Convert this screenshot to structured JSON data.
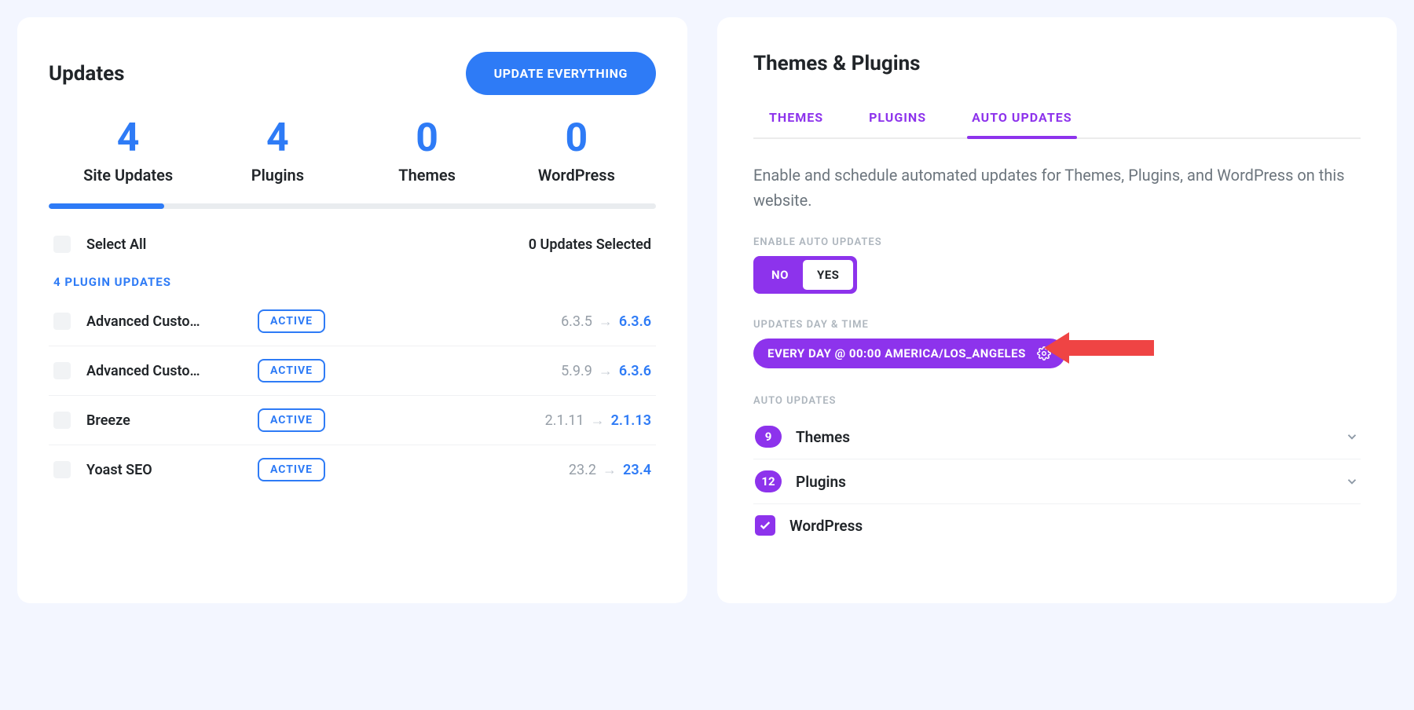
{
  "updates": {
    "title": "Updates",
    "update_all_label": "UPDATE EVERYTHING",
    "stats": {
      "site_updates": {
        "value": "4",
        "label": "Site Updates"
      },
      "plugins": {
        "value": "4",
        "label": "Plugins"
      },
      "themes": {
        "value": "0",
        "label": "Themes"
      },
      "wordpress": {
        "value": "0",
        "label": "WordPress"
      }
    },
    "select_all_label": "Select All",
    "selected_count_text": "0 Updates Selected",
    "plugin_section_title": "4 PLUGIN UPDATES",
    "plugins_list": [
      {
        "name": "Advanced Custo…",
        "status": "ACTIVE",
        "from": "6.3.5",
        "to": "6.3.6"
      },
      {
        "name": "Advanced Custo…",
        "status": "ACTIVE",
        "from": "5.9.9",
        "to": "6.3.6"
      },
      {
        "name": "Breeze",
        "status": "ACTIVE",
        "from": "2.1.11",
        "to": "2.1.13"
      },
      {
        "name": "Yoast SEO",
        "status": "ACTIVE",
        "from": "23.2",
        "to": "23.4"
      }
    ]
  },
  "themes_plugins": {
    "title": "Themes & Plugins",
    "tabs": {
      "themes": "THEMES",
      "plugins": "PLUGINS",
      "auto": "AUTO UPDATES"
    },
    "active_tab": "auto",
    "description": "Enable and schedule automated updates for Themes, Plugins, and WordPress on this website.",
    "enable_label": "ENABLE AUTO UPDATES",
    "toggle": {
      "no": "NO",
      "yes": "YES",
      "value": "YES"
    },
    "schedule_label": "UPDATES DAY & TIME",
    "schedule_value": "EVERY DAY  @ 00:00  AMERICA/LOS_ANGELES",
    "section_label": "AUTO UPDATES",
    "items": [
      {
        "count": "9",
        "name": "Themes",
        "expandable": true
      },
      {
        "count": "12",
        "name": "Plugins",
        "expandable": true
      },
      {
        "checked": true,
        "name": "WordPress",
        "expandable": false
      }
    ]
  }
}
